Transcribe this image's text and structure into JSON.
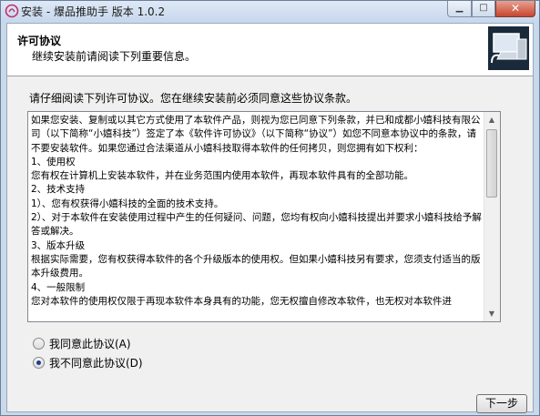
{
  "window": {
    "title": "安装 - 爆品推助手 版本 1.0.2",
    "minimize_glyph": "▁",
    "maximize_glyph": "□",
    "close_glyph": "✕"
  },
  "header": {
    "title": "许可协议",
    "subtitle": "继续安装前请阅读下列重要信息。"
  },
  "body": {
    "intro": "请仔细阅读下列许可协议。您在继续安装前必须同意这些协议条款。",
    "license_text": "如果您安装、复制或以其它方式使用了本软件产品，则视为您已同意下列条款，并已和成都小嬉科技有限公司（以下简称“小嬉科技”）签定了本《软件许可协议》（以下简称“协议”）如您不同意本协议中的条款，请不要安装软件。如果您通过合法渠道从小嬉科技取得本软件的任何拷贝，则您拥有如下权利：\n1、使用权\n您有权在计算机上安装本软件，并在业务范围内使用本软件，再现本软件具有的全部功能。\n2、技术支持\n1）、您有权获得小嬉科技的全面的技术支持。\n2）、对于本软件在安装使用过程中产生的任何疑问、问题，您均有权向小嬉科技提出并要求小嬉科技给予解答或解决。\n3、版本升级\n根据实际需要，您有权获得本软件的各个升级版本的使用权。但如果小嬉科技另有要求，您须支付适当的版本升级费用。\n4、一般限制\n您对本软件的使用权仅限于再现本软件本身具有的功能，您无权擅自修改本软件，也无权对本软件进"
  },
  "options": {
    "accept_label": "我同意此协议(A)",
    "decline_label": "我不同意此协议(D)",
    "selected": "decline"
  },
  "buttons": {
    "next_label": "下一步"
  },
  "icons": {
    "app_icon": "app-logo-icon",
    "installer_logo": "computer-install-icon",
    "scroll_up": "arrow-up-icon",
    "scroll_down": "arrow-down-icon"
  }
}
